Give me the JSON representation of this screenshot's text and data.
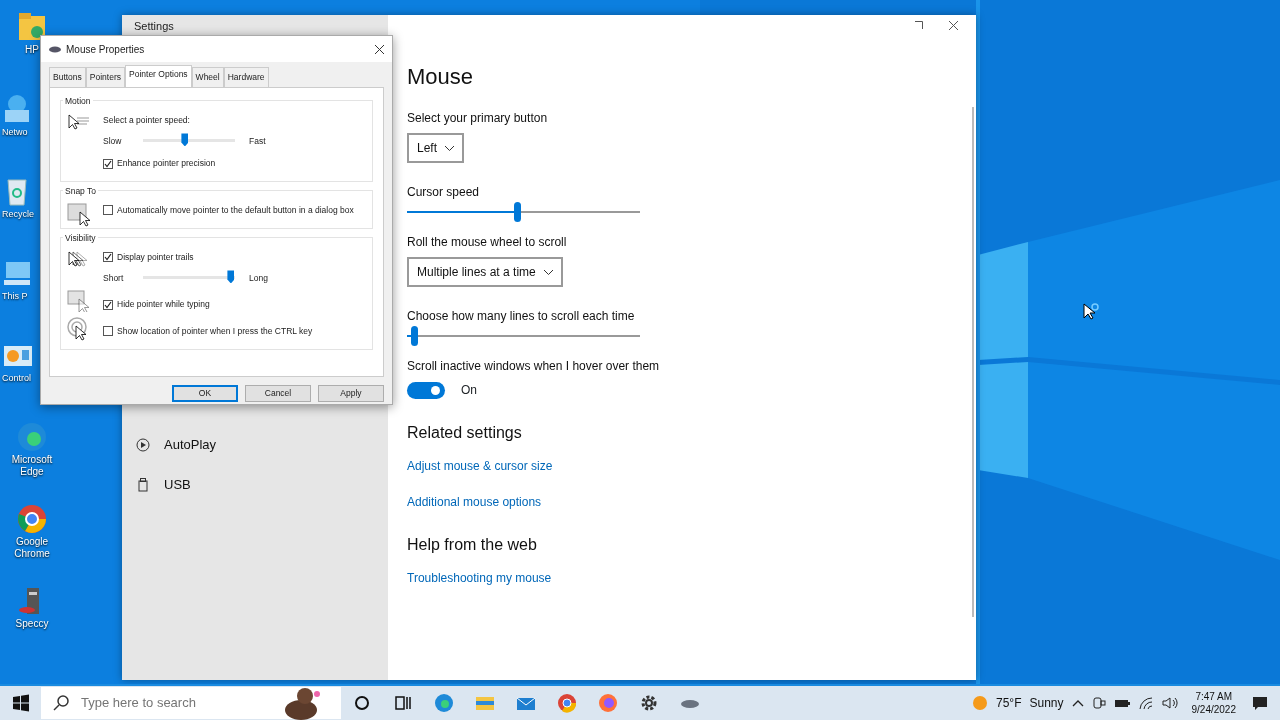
{
  "desktop_icons": [
    {
      "label": "HP"
    },
    {
      "label": "Netwo"
    },
    {
      "label": "Recycle"
    },
    {
      "label": "This P"
    },
    {
      "label": "Control"
    },
    {
      "label": "Microsoft Edge"
    },
    {
      "label": "Google Chrome"
    },
    {
      "label": "Speccy"
    }
  ],
  "settings": {
    "title": "Settings",
    "sidebar_items": [
      {
        "label": "AutoPlay"
      },
      {
        "label": "USB"
      }
    ],
    "heading": "Mouse",
    "rows": [
      {
        "kind": "dropdown",
        "label": "Select your primary button",
        "value": "Left"
      },
      {
        "kind": "slider",
        "label": "Cursor speed",
        "level": 0.47
      },
      {
        "kind": "dropdown",
        "label": "Roll the mouse wheel to scroll",
        "value": "Multiple lines at a time"
      },
      {
        "kind": "slider",
        "label": "Choose how many lines to scroll each time",
        "level": 0.03
      },
      {
        "kind": "toggle",
        "label": "Scroll inactive windows when I hover over them",
        "on": true,
        "state_text": "On"
      }
    ],
    "sections": [
      {
        "title": "Related settings",
        "links": [
          "Adjust mouse & cursor size",
          "Additional mouse options"
        ]
      },
      {
        "title": "Help from the web",
        "links": [
          "Troubleshooting my mouse"
        ]
      }
    ]
  },
  "dialog": {
    "title": "Mouse Properties",
    "tabs": [
      {
        "label": "Buttons",
        "selected": false
      },
      {
        "label": "Pointers",
        "selected": false
      },
      {
        "label": "Pointer Options",
        "selected": true
      },
      {
        "label": "Wheel",
        "selected": false
      },
      {
        "label": "Hardware",
        "selected": false
      }
    ],
    "groups": [
      {
        "title": "Motion",
        "items": [
          {
            "kind": "text",
            "text": "Select a pointer speed:"
          },
          {
            "kind": "slider",
            "min_label": "Slow",
            "max_label": "Fast",
            "level": 0.45
          },
          {
            "kind": "checkbox",
            "label": "Enhance pointer precision",
            "checked": true
          }
        ]
      },
      {
        "title": "Snap To",
        "items": [
          {
            "kind": "checkbox",
            "label": "Automatically move pointer to the default button in a dialog box",
            "checked": false
          }
        ]
      },
      {
        "title": "Visibility",
        "items": [
          {
            "kind": "checkbox",
            "label": "Display pointer trails",
            "checked": true
          },
          {
            "kind": "slider",
            "min_label": "Short",
            "max_label": "Long",
            "level": 0.95
          },
          {
            "kind": "checkbox",
            "label": "Hide pointer while typing",
            "checked": true
          },
          {
            "kind": "checkbox",
            "label": "Show location of pointer when I press the CTRL key",
            "checked": false
          }
        ]
      }
    ],
    "buttons": [
      "OK",
      "Cancel",
      "Apply"
    ]
  },
  "taskbar": {
    "search_placeholder": "Type here to search",
    "temperature": "75°F",
    "weather": "Sunny",
    "time": "7:47 AM",
    "date": "9/24/2022"
  }
}
